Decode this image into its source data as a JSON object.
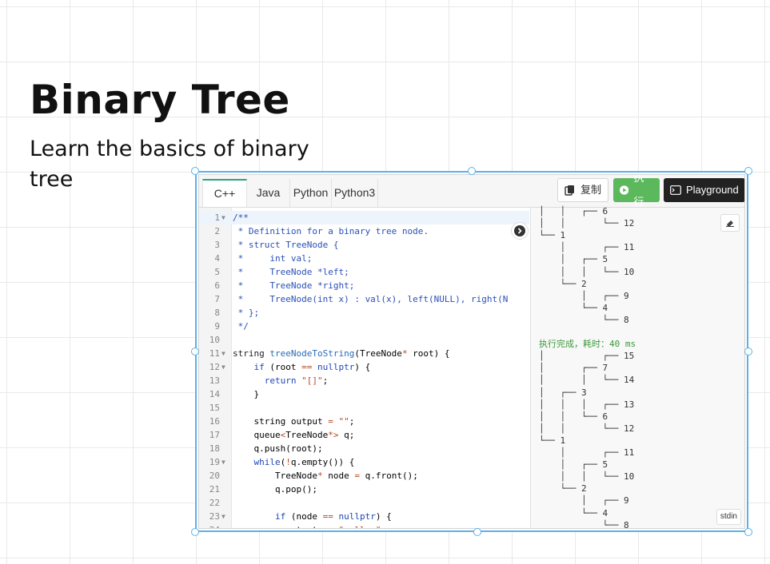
{
  "page": {
    "title": "Binary Tree",
    "subtitle": "Learn the basics of binary tree"
  },
  "colors": {
    "accent": "#5ab1e8",
    "run": "#5cb85c",
    "playground": "#222222",
    "keyword": "#1f46b8",
    "string": "#b64a24",
    "success": "#3a9a3a"
  },
  "tabs": [
    {
      "label": "C++",
      "active": true
    },
    {
      "label": "Java",
      "active": false
    },
    {
      "label": "Python",
      "active": false
    },
    {
      "label": "Python3",
      "active": false
    }
  ],
  "toolbar": {
    "copy_label": "复制",
    "copy_icon": "copy-icon",
    "run_label": "执行",
    "run_icon": "play-icon",
    "playground_label": "Playground",
    "playground_icon": "terminal-icon"
  },
  "code_lines": [
    {
      "n": "1",
      "fold": true,
      "hl": true,
      "segs": [
        [
          "c-comment",
          "/**"
        ]
      ]
    },
    {
      "n": "2",
      "segs": [
        [
          "c-comment",
          " * Definition for a binary tree node."
        ]
      ]
    },
    {
      "n": "3",
      "segs": [
        [
          "c-comment",
          " * struct TreeNode {"
        ]
      ]
    },
    {
      "n": "4",
      "segs": [
        [
          "c-comment",
          " *     int val;"
        ]
      ]
    },
    {
      "n": "5",
      "segs": [
        [
          "c-comment",
          " *     TreeNode *left;"
        ]
      ]
    },
    {
      "n": "6",
      "segs": [
        [
          "c-comment",
          " *     TreeNode *right;"
        ]
      ]
    },
    {
      "n": "7",
      "segs": [
        [
          "c-comment",
          " *     TreeNode(int x) : val(x), left(NULL), right(N"
        ]
      ]
    },
    {
      "n": "8",
      "segs": [
        [
          "c-comment",
          " * };"
        ]
      ]
    },
    {
      "n": "9",
      "segs": [
        [
          "c-comment",
          " */"
        ]
      ]
    },
    {
      "n": "10",
      "segs": []
    },
    {
      "n": "11",
      "fold": true,
      "segs": [
        [
          "c-type",
          "string "
        ],
        [
          "c-fn",
          "treeNodeToString"
        ],
        [
          "",
          "(TreeNode"
        ],
        [
          "c-str",
          "*"
        ],
        [
          "",
          " root) {"
        ]
      ]
    },
    {
      "n": "12",
      "fold": true,
      "segs": [
        [
          "",
          "    "
        ],
        [
          "c-kw",
          "if"
        ],
        [
          "",
          " (root "
        ],
        [
          "c-str",
          "=="
        ],
        [
          "",
          " "
        ],
        [
          "c-kw",
          "nullptr"
        ],
        [
          "",
          ") {"
        ]
      ]
    },
    {
      "n": "13",
      "segs": [
        [
          "",
          "      "
        ],
        [
          "c-kw",
          "return"
        ],
        [
          "",
          " "
        ],
        [
          "c-str",
          "\"[]\""
        ],
        [
          "",
          ";"
        ]
      ]
    },
    {
      "n": "14",
      "segs": [
        [
          "",
          "    }"
        ]
      ]
    },
    {
      "n": "15",
      "segs": []
    },
    {
      "n": "16",
      "segs": [
        [
          "",
          "    string output "
        ],
        [
          "c-str",
          "="
        ],
        [
          "",
          " "
        ],
        [
          "c-str",
          "\"\""
        ],
        [
          "",
          ";"
        ]
      ]
    },
    {
      "n": "17",
      "segs": [
        [
          "",
          "    queue"
        ],
        [
          "c-str",
          "<"
        ],
        [
          "",
          "TreeNode"
        ],
        [
          "c-str",
          "*>"
        ],
        [
          "",
          " q;"
        ]
      ]
    },
    {
      "n": "18",
      "segs": [
        [
          "",
          "    q.push(root);"
        ]
      ]
    },
    {
      "n": "19",
      "fold": true,
      "segs": [
        [
          "",
          "    "
        ],
        [
          "c-kw",
          "while"
        ],
        [
          "",
          "("
        ],
        [
          "c-str",
          "!"
        ],
        [
          "",
          "q.empty()) {"
        ]
      ]
    },
    {
      "n": "20",
      "segs": [
        [
          "",
          "        TreeNode"
        ],
        [
          "c-str",
          "*"
        ],
        [
          "",
          " node "
        ],
        [
          "c-str",
          "="
        ],
        [
          "",
          " q.front();"
        ]
      ]
    },
    {
      "n": "21",
      "segs": [
        [
          "",
          "        q.pop();"
        ]
      ]
    },
    {
      "n": "22",
      "segs": []
    },
    {
      "n": "23",
      "fold": true,
      "segs": [
        [
          "",
          "        "
        ],
        [
          "c-kw",
          "if"
        ],
        [
          "",
          " (node "
        ],
        [
          "c-str",
          "=="
        ],
        [
          "",
          " "
        ],
        [
          "c-kw",
          "nullptr"
        ],
        [
          "",
          ") {"
        ]
      ]
    },
    {
      "n": "24",
      "segs": [
        [
          "",
          "          output "
        ],
        [
          "c-str",
          "+="
        ],
        [
          "",
          " "
        ],
        [
          "c-str",
          "\"null, \""
        ],
        [
          "",
          ";"
        ]
      ]
    }
  ],
  "output_lines": [
    {
      "t": "│   │   ┌── 6"
    },
    {
      "t": "│   │       └── 12"
    },
    {
      "t": "└── 1"
    },
    {
      "t": "    │       ┌── 11"
    },
    {
      "t": "    │   ┌── 5"
    },
    {
      "t": "    │   │   └── 10"
    },
    {
      "t": "    └── 2"
    },
    {
      "t": "        │   ┌── 9"
    },
    {
      "t": "        └── 4"
    },
    {
      "t": "            └── 8"
    },
    {
      "t": ""
    },
    {
      "t": "执行完成，耗时：40 ms",
      "ok": true
    },
    {
      "t": "│           ┌── 15"
    },
    {
      "t": "│       ┌── 7"
    },
    {
      "t": "│       │   └── 14"
    },
    {
      "t": "│   ┌── 3"
    },
    {
      "t": "│   │   │   ┌── 13"
    },
    {
      "t": "│   │   └── 6"
    },
    {
      "t": "│   │       └── 12"
    },
    {
      "t": "└── 1"
    },
    {
      "t": "    │       ┌── 11"
    },
    {
      "t": "    │   ┌── 5"
    },
    {
      "t": "    │   │   └── 10"
    },
    {
      "t": "    └── 2"
    },
    {
      "t": "        │   ┌── 9"
    },
    {
      "t": "        └── 4"
    },
    {
      "t": "            └── 8"
    }
  ],
  "output_panel": {
    "stdin_label": "stdin",
    "eraser_icon": "eraser-icon",
    "collapse_icon": "chevron-right-icon"
  }
}
